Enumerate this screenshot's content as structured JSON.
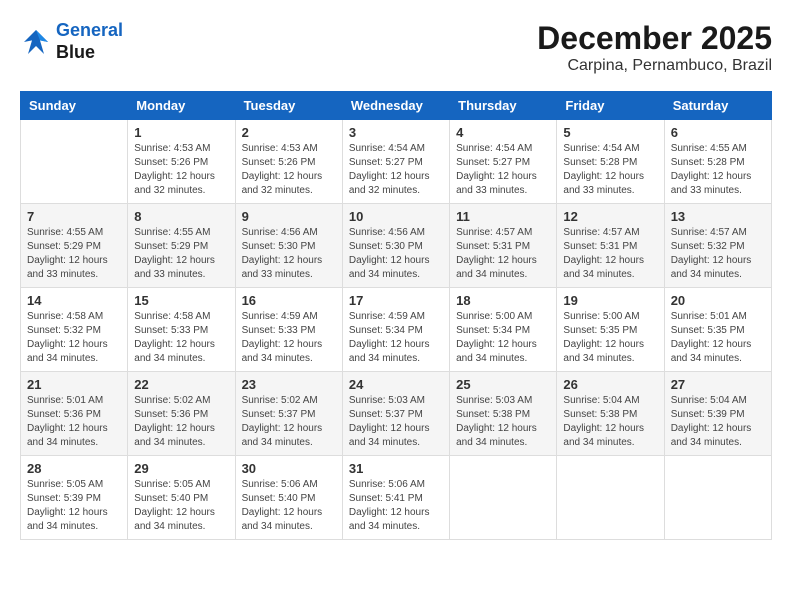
{
  "logo": {
    "line1": "General",
    "line2": "Blue"
  },
  "title": "December 2025",
  "subtitle": "Carpina, Pernambuco, Brazil",
  "days": [
    "Sunday",
    "Monday",
    "Tuesday",
    "Wednesday",
    "Thursday",
    "Friday",
    "Saturday"
  ],
  "weeks": [
    [
      {
        "num": "",
        "info": ""
      },
      {
        "num": "1",
        "info": "Sunrise: 4:53 AM\nSunset: 5:26 PM\nDaylight: 12 hours\nand 32 minutes."
      },
      {
        "num": "2",
        "info": "Sunrise: 4:53 AM\nSunset: 5:26 PM\nDaylight: 12 hours\nand 32 minutes."
      },
      {
        "num": "3",
        "info": "Sunrise: 4:54 AM\nSunset: 5:27 PM\nDaylight: 12 hours\nand 32 minutes."
      },
      {
        "num": "4",
        "info": "Sunrise: 4:54 AM\nSunset: 5:27 PM\nDaylight: 12 hours\nand 33 minutes."
      },
      {
        "num": "5",
        "info": "Sunrise: 4:54 AM\nSunset: 5:28 PM\nDaylight: 12 hours\nand 33 minutes."
      },
      {
        "num": "6",
        "info": "Sunrise: 4:55 AM\nSunset: 5:28 PM\nDaylight: 12 hours\nand 33 minutes."
      }
    ],
    [
      {
        "num": "7",
        "info": "Sunrise: 4:55 AM\nSunset: 5:29 PM\nDaylight: 12 hours\nand 33 minutes."
      },
      {
        "num": "8",
        "info": "Sunrise: 4:55 AM\nSunset: 5:29 PM\nDaylight: 12 hours\nand 33 minutes."
      },
      {
        "num": "9",
        "info": "Sunrise: 4:56 AM\nSunset: 5:30 PM\nDaylight: 12 hours\nand 33 minutes."
      },
      {
        "num": "10",
        "info": "Sunrise: 4:56 AM\nSunset: 5:30 PM\nDaylight: 12 hours\nand 34 minutes."
      },
      {
        "num": "11",
        "info": "Sunrise: 4:57 AM\nSunset: 5:31 PM\nDaylight: 12 hours\nand 34 minutes."
      },
      {
        "num": "12",
        "info": "Sunrise: 4:57 AM\nSunset: 5:31 PM\nDaylight: 12 hours\nand 34 minutes."
      },
      {
        "num": "13",
        "info": "Sunrise: 4:57 AM\nSunset: 5:32 PM\nDaylight: 12 hours\nand 34 minutes."
      }
    ],
    [
      {
        "num": "14",
        "info": "Sunrise: 4:58 AM\nSunset: 5:32 PM\nDaylight: 12 hours\nand 34 minutes."
      },
      {
        "num": "15",
        "info": "Sunrise: 4:58 AM\nSunset: 5:33 PM\nDaylight: 12 hours\nand 34 minutes."
      },
      {
        "num": "16",
        "info": "Sunrise: 4:59 AM\nSunset: 5:33 PM\nDaylight: 12 hours\nand 34 minutes."
      },
      {
        "num": "17",
        "info": "Sunrise: 4:59 AM\nSunset: 5:34 PM\nDaylight: 12 hours\nand 34 minutes."
      },
      {
        "num": "18",
        "info": "Sunrise: 5:00 AM\nSunset: 5:34 PM\nDaylight: 12 hours\nand 34 minutes."
      },
      {
        "num": "19",
        "info": "Sunrise: 5:00 AM\nSunset: 5:35 PM\nDaylight: 12 hours\nand 34 minutes."
      },
      {
        "num": "20",
        "info": "Sunrise: 5:01 AM\nSunset: 5:35 PM\nDaylight: 12 hours\nand 34 minutes."
      }
    ],
    [
      {
        "num": "21",
        "info": "Sunrise: 5:01 AM\nSunset: 5:36 PM\nDaylight: 12 hours\nand 34 minutes."
      },
      {
        "num": "22",
        "info": "Sunrise: 5:02 AM\nSunset: 5:36 PM\nDaylight: 12 hours\nand 34 minutes."
      },
      {
        "num": "23",
        "info": "Sunrise: 5:02 AM\nSunset: 5:37 PM\nDaylight: 12 hours\nand 34 minutes."
      },
      {
        "num": "24",
        "info": "Sunrise: 5:03 AM\nSunset: 5:37 PM\nDaylight: 12 hours\nand 34 minutes."
      },
      {
        "num": "25",
        "info": "Sunrise: 5:03 AM\nSunset: 5:38 PM\nDaylight: 12 hours\nand 34 minutes."
      },
      {
        "num": "26",
        "info": "Sunrise: 5:04 AM\nSunset: 5:38 PM\nDaylight: 12 hours\nand 34 minutes."
      },
      {
        "num": "27",
        "info": "Sunrise: 5:04 AM\nSunset: 5:39 PM\nDaylight: 12 hours\nand 34 minutes."
      }
    ],
    [
      {
        "num": "28",
        "info": "Sunrise: 5:05 AM\nSunset: 5:39 PM\nDaylight: 12 hours\nand 34 minutes."
      },
      {
        "num": "29",
        "info": "Sunrise: 5:05 AM\nSunset: 5:40 PM\nDaylight: 12 hours\nand 34 minutes."
      },
      {
        "num": "30",
        "info": "Sunrise: 5:06 AM\nSunset: 5:40 PM\nDaylight: 12 hours\nand 34 minutes."
      },
      {
        "num": "31",
        "info": "Sunrise: 5:06 AM\nSunset: 5:41 PM\nDaylight: 12 hours\nand 34 minutes."
      },
      {
        "num": "",
        "info": ""
      },
      {
        "num": "",
        "info": ""
      },
      {
        "num": "",
        "info": ""
      }
    ]
  ]
}
